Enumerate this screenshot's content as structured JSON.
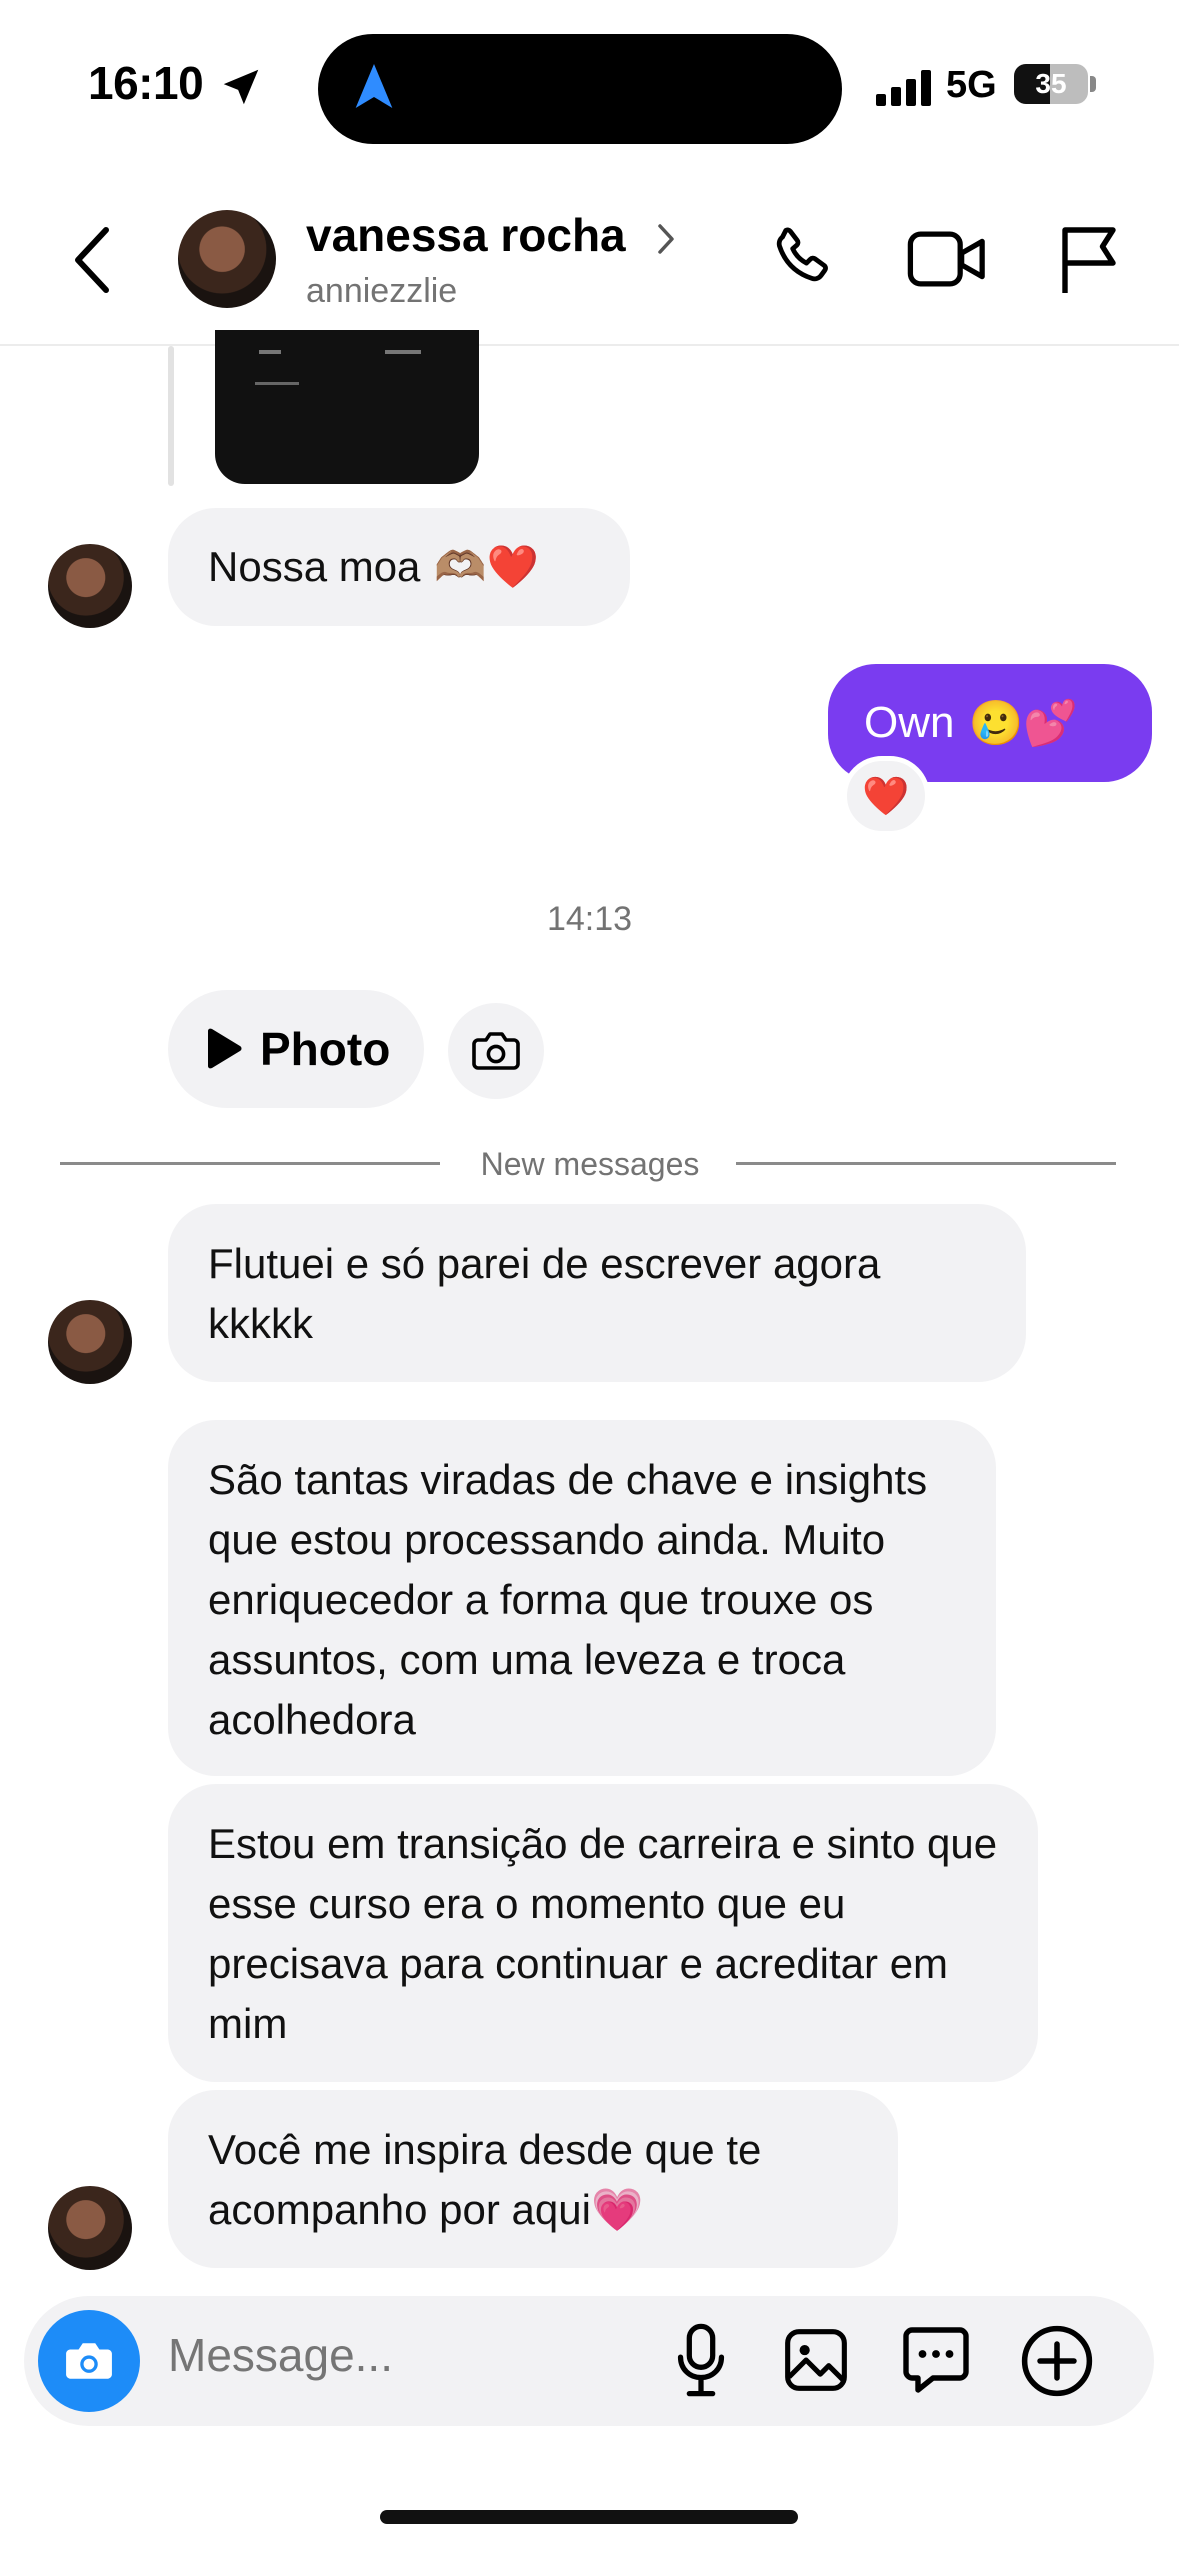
{
  "status_bar": {
    "time": "16:10",
    "network": "5G",
    "battery": "35",
    "icons": [
      "location-arrow-icon",
      "navigation-arrow-icon",
      "signal-bars-icon",
      "battery-icon"
    ]
  },
  "header": {
    "name": "vanessa rocha",
    "username": "anniezzlie",
    "icons": [
      "back-chevron-icon",
      "chevron-right-icon",
      "phone-icon",
      "video-camera-icon",
      "flag-icon"
    ]
  },
  "messages": {
    "m1_text": "Nossa moa",
    "m1_emoji": "🫶🏽❤️",
    "m2_text": "Own",
    "m2_emoji": "🥲💕",
    "m2_reaction": "❤️",
    "timestamp": "14:13",
    "photo_label": "Photo",
    "new_messages": "New messages",
    "m3_text": "Flutuei e só parei de escrever agora kkkkk",
    "m4_text": "São tantas viradas de chave e insights que estou processando ainda. Muito enriquecedor a forma que trouxe os assuntos, com uma leveza e troca acolhedora",
    "m5_text": "Estou em transição de carreira e sinto que esse curso era o momento que eu precisava para continuar e acreditar em mim",
    "m6_text": "Você me inspira desde que te acompanho por aqui",
    "m6_emoji": "💗"
  },
  "composer": {
    "placeholder": "Message...",
    "icons": [
      "camera-icon",
      "microphone-icon",
      "gallery-icon",
      "sticker-chat-icon",
      "plus-circle-icon"
    ]
  },
  "colors": {
    "outgoing_bubble": "#7a3cf0",
    "incoming_bubble": "#f2f2f4",
    "camera_button": "#1d8cf8",
    "secondary_text": "#737373"
  }
}
